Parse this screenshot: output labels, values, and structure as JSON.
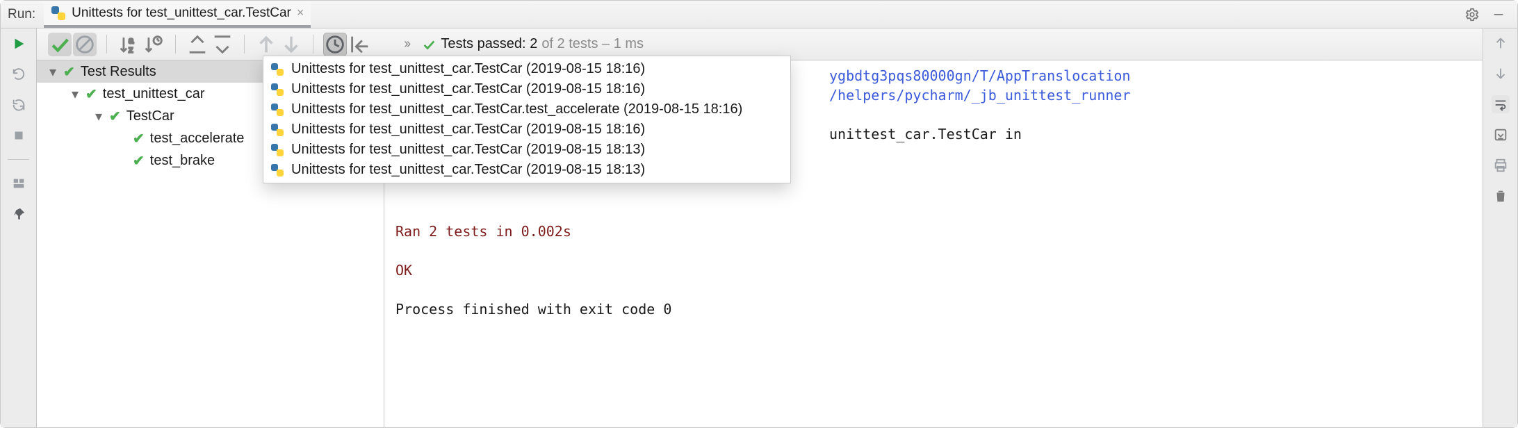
{
  "topbar": {
    "run_label": "Run:",
    "tab_title": "Unittests for test_unittest_car.TestCar"
  },
  "toolbar": {
    "status_passed_prefix": "Tests passed:",
    "status_count": "2",
    "status_of": "of 2 tests",
    "status_time": "1 ms"
  },
  "tree": {
    "root": "Test Results",
    "module": "test_unittest_car",
    "class": "TestCar",
    "tests": [
      "test_accelerate",
      "test_brake"
    ]
  },
  "history": [
    "Unittests for test_unittest_car.TestCar (2019-08-15 18:16)",
    "Unittests for test_unittest_car.TestCar (2019-08-15 18:16)",
    "Unittests for test_unittest_car.TestCar.test_accelerate (2019-08-15 18:16)",
    "Unittests for test_unittest_car.TestCar (2019-08-15 18:16)",
    "Unittests for test_unittest_car.TestCar (2019-08-15 18:13)",
    "Unittests for test_unittest_car.TestCar (2019-08-15 18:13)"
  ],
  "console": {
    "line1_right": "ygbdtg3pqs80000gn/T/AppTranslocation",
    "line2_right": "/helpers/pycharm/_jb_unittest_runner",
    "blank1": "",
    "line3_right": "unittest_car.TestCar in",
    "ran": "Ran 2 tests in 0.002s",
    "ok": "OK",
    "exit": "Process finished with exit code 0"
  }
}
